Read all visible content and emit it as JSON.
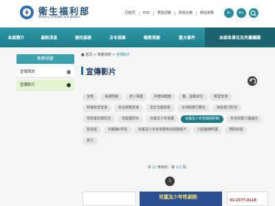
{
  "header": {
    "title": "衛生福利部",
    "subtitle_en": "Ministry of Health and Welfare",
    "toplinks": [
      "回首頁",
      "RSS",
      "雙語詞彙",
      "部長信箱",
      "網站導覽"
    ],
    "font_small": "A-",
    "font_large": "A+"
  },
  "nav": {
    "items": [
      "本部簡介",
      "最新消息",
      "便民服務",
      "法令規章",
      "衛教視窗",
      "重大事件",
      "本部各單位及所屬機關"
    ]
  },
  "sidebar": {
    "heading": "衛教視窗",
    "items": [
      {
        "label": "宣傳資訊"
      },
      {
        "label": "宣傳影片"
      }
    ]
  },
  "breadcrumb": {
    "home": "首頁",
    "level1": "衛教視窗",
    "current": "宣傳影片"
  },
  "page": {
    "title": "宣傳影片"
  },
  "tags": [
    "全部",
    "長期照顧",
    "老人保護",
    "孕產婦健康",
    "藥、酒癮戒治",
    "鄰里宣導",
    "政策影音宣導",
    "綜合衛教宣導",
    "急診五級檢傷",
    "在地服務行動化",
    "家庭暴力防治",
    "性侵害犯罪防治",
    "性騷擾防治",
    "兒童及少年保護",
    "兒童及少年性剝削防制",
    "反性別暴力倡議志",
    "緊急傷",
    "中醫藥e學習",
    "兒童及少年未來教育與發展帳戶",
    "口腔醫療照護",
    "預防衛福",
    "其它"
  ],
  "active_tag": "兒童及少年性剝削防制",
  "stats": {
    "prefix": "共",
    "count": "11",
    "mid1": "筆資料，第",
    "page": "1/1",
    "suffix": "頁。"
  },
  "pager": {
    "current": "1"
  },
  "thumbnails": {
    "banner_text": "兒童及少年性剝削",
    "hotline": "02-2577-8118"
  },
  "colors": {
    "teal": "#2a8d9c",
    "nav": "#2f97a5",
    "active_tag": "#1d7b89",
    "sidebar_active": "#e4f4cf"
  }
}
